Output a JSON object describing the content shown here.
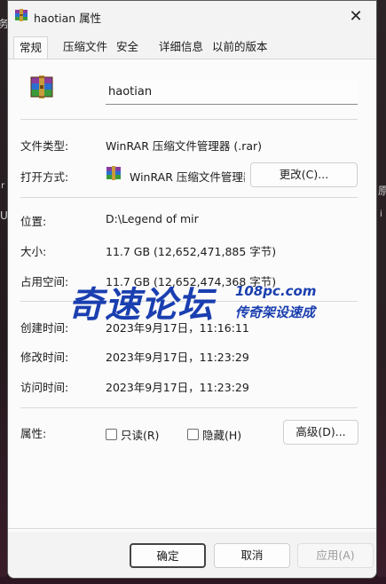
{
  "window": {
    "title": "haotian 属性",
    "close_glyph": "✕"
  },
  "backdrop": {
    "left_char_1": "务",
    "left_char_2": ".r",
    "left_char_3": "U",
    "right_char_1": "原",
    "right_char_2": "i"
  },
  "tabs": [
    {
      "label": "常规",
      "active": true
    },
    {
      "label": "压缩文件",
      "active": false
    },
    {
      "label": "安全",
      "active": false
    },
    {
      "label": "详细信息",
      "active": false
    },
    {
      "label": "以前的版本",
      "active": false
    }
  ],
  "general": {
    "file_name": "haotian",
    "file_type_label": "文件类型:",
    "file_type_value": "WinRAR 压缩文件管理器 (.rar)",
    "opens_with_label": "打开方式:",
    "opens_with_value": "WinRAR 压缩文件管理器",
    "change_button": "更改(C)...",
    "location_label": "位置:",
    "location_value": "D:\\Legend of mir",
    "size_label": "大小:",
    "size_value": "11.7 GB (12,652,471,885 字节)",
    "size_on_disk_label": "占用空间:",
    "size_on_disk_value": "11.7 GB (12,652,474,368 字节)",
    "created_label": "创建时间:",
    "created_value": "2023年9月17日，11:16:11",
    "modified_label": "修改时间:",
    "modified_value": "2023年9月17日，11:23:29",
    "accessed_label": "访问时间:",
    "accessed_value": "2023年9月17日，11:23:29",
    "attributes_label": "属性:",
    "readonly_label": "只读(R)",
    "readonly_checked": false,
    "hidden_label": "隐藏(H)",
    "hidden_checked": false,
    "advanced_button": "高级(D)..."
  },
  "footer": {
    "ok": "确定",
    "cancel": "取消",
    "apply": "应用(A)"
  },
  "watermark": {
    "main": "奇速论坛",
    "domain": "108pc.com",
    "slogan": "传奇架设速成"
  },
  "icons": {
    "title": "winrar-archive-icon",
    "file": "winrar-archive-icon",
    "opens_with": "winrar-app-icon",
    "close": "close-icon"
  },
  "colors": {
    "accent_watermark": "#1a3fb0",
    "window_bg": "#f3f3f3"
  }
}
